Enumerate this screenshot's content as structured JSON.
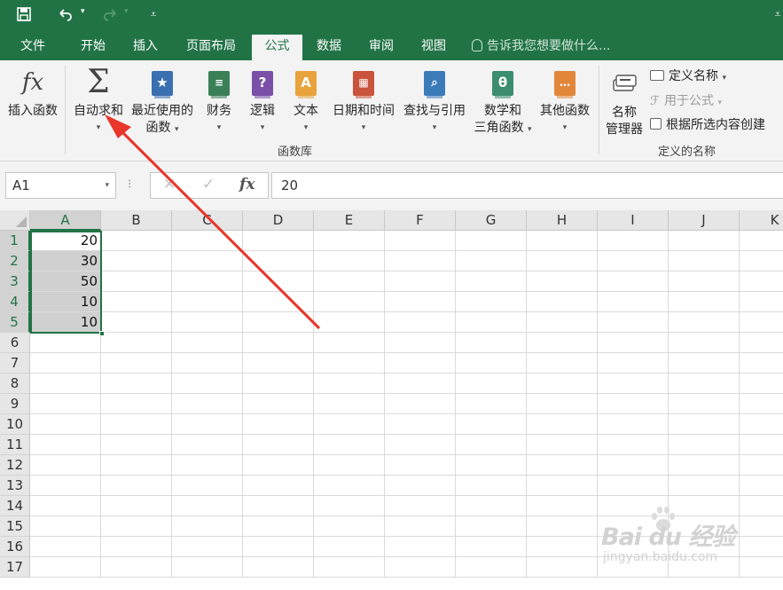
{
  "quick_access": {
    "save_icon": "save-icon",
    "undo_icon": "undo-icon",
    "redo_icon": "redo-icon",
    "customize_icon": "customize-icon"
  },
  "tabs": [
    "文件",
    "开始",
    "插入",
    "页面布局",
    "公式",
    "数据",
    "审阅",
    "视图"
  ],
  "active_tab": "公式",
  "tell_me": "告诉我您想要做什么...",
  "ribbon": {
    "insert_function": "插入函数",
    "autosum": "自动求和",
    "recent_line1": "最近使用的",
    "recent_line2": "函数",
    "financial": "财务",
    "logical": "逻辑",
    "text": "文本",
    "datetime": "日期和时间",
    "lookup": "查找与引用",
    "math_line1": "数学和",
    "math_line2": "三角函数",
    "more": "其他函数",
    "group_library": "函数库",
    "name_manager_line1": "名称",
    "name_manager_line2": "管理器",
    "define_name": "定义名称",
    "use_in_formula": "用于公式",
    "create_from_selection": "根据所选内容创建",
    "group_defined_names": "定义的名称",
    "colors": {
      "financial": "#3b7f57",
      "logical": "#7a4fa8",
      "text": "#e8a33c",
      "datetime": "#c9533c",
      "lookup": "#3c7bb9",
      "math": "#3b8d6e",
      "more": "#e2873a",
      "recent": "#3a6fb0"
    }
  },
  "formula_bar": {
    "name_box": "A1",
    "formula": "20",
    "fx_label": "fx"
  },
  "columns": [
    "A",
    "B",
    "C",
    "D",
    "E",
    "F",
    "G",
    "H",
    "I",
    "J",
    "K"
  ],
  "rows": [
    "1",
    "2",
    "3",
    "4",
    "5",
    "6",
    "7",
    "8",
    "9",
    "10",
    "11",
    "12",
    "13",
    "14",
    "15",
    "16",
    "17"
  ],
  "cells": {
    "A1": "20",
    "A2": "30",
    "A3": "50",
    "A4": "10",
    "A5": "10"
  },
  "watermark": {
    "brand": "Bai du 经验",
    "url": "jingyan.baidu.com"
  },
  "theme": {
    "accent": "#217346",
    "arrow": "#e8362b"
  }
}
